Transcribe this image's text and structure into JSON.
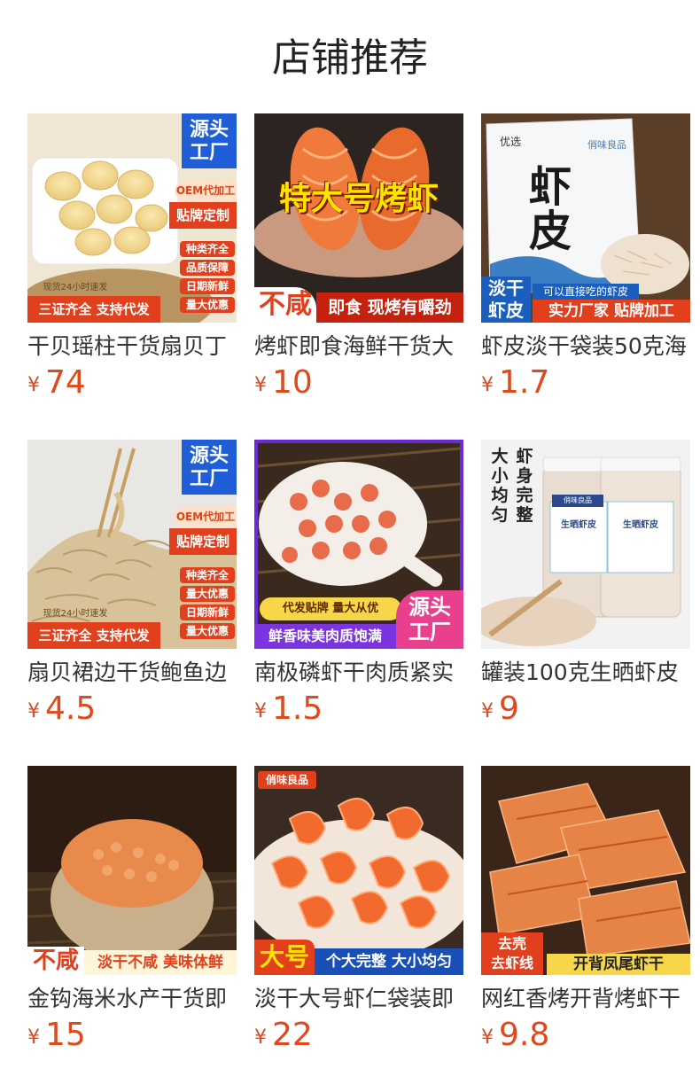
{
  "section": {
    "title": "店铺推荐"
  },
  "currency": "¥",
  "products": [
    {
      "title": "干贝瑶柱干货扇贝丁",
      "price": "74",
      "badges": {
        "source": "源头\n工厂",
        "oem": "OEM代加工",
        "custom": "贴牌定制",
        "tags": [
          "种类齐全",
          "品质保障",
          "日期新鲜",
          "量大优惠"
        ],
        "ship": "现货24小时速发",
        "bottom": "三证齐全 支持代发"
      }
    },
    {
      "title": "烤虾即食海鲜干货大",
      "price": "10",
      "badges": {
        "headline": "特大号烤虾",
        "left": "不咸",
        "right": "即食 现烤有嚼劲"
      }
    },
    {
      "title": "虾皮淡干袋装50克海",
      "price": "1.7",
      "badges": {
        "pack": "虾皮",
        "packTop": "优选",
        "packSide": "俏味良品",
        "left": "淡干\n虾皮",
        "note": "可以直接吃的虾皮",
        "right": "实力厂家 贴牌加工"
      }
    },
    {
      "title": "扇贝裙边干货鲍鱼边",
      "price": "4.5",
      "badges": {
        "source": "源头\n工厂",
        "oem": "OEM代加工",
        "custom": "贴牌定制",
        "tags": [
          "种类齐全",
          "量大优惠",
          "日期新鲜",
          "量大优惠"
        ],
        "ship": "现货24小时速发",
        "bottom": "三证齐全 支持代发"
      }
    },
    {
      "title": "南极磷虾干肉质紧实",
      "price": "1.5",
      "badges": {
        "banner": "代发贴牌  量大从优",
        "source": "源头\n工厂",
        "bottom": "鲜香味美肉质饱满"
      }
    },
    {
      "title": "罐装100克生晒虾皮",
      "price": "9",
      "badges": {
        "side1": "大小均匀",
        "side2": "虾身完整",
        "label": "生晒虾皮",
        "brand": "俏味良品"
      }
    },
    {
      "title": "金钩海米水产干货即",
      "price": "15",
      "badges": {
        "left": "不咸",
        "right": "淡干不咸 美味体鲜"
      }
    },
    {
      "title": "淡干大号虾仁袋装即",
      "price": "22",
      "badges": {
        "brand": "俏味良品",
        "left": "大号",
        "right": "个大完整 大小均匀"
      }
    },
    {
      "title": "网红香烤开背烤虾干",
      "price": "9.8",
      "badges": {
        "left": "去壳\n去虾线",
        "right": "开背凤尾虾干"
      }
    }
  ]
}
